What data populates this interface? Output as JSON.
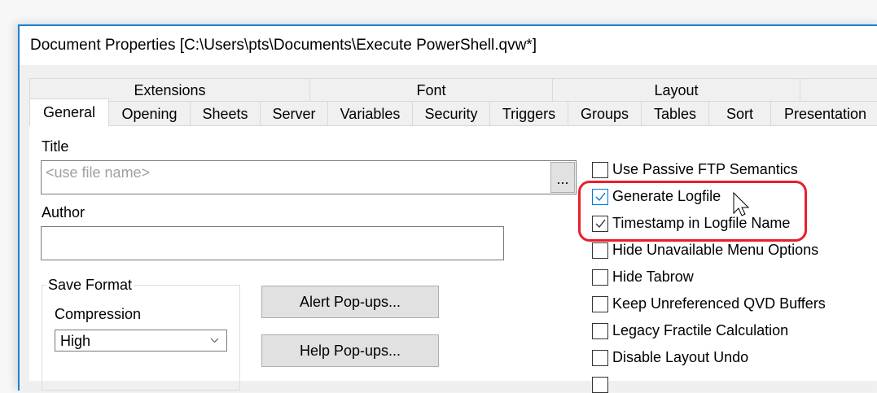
{
  "window": {
    "title": "Document Properties [C:\\Users\\pts\\Documents\\Execute PowerShell.qvw*]"
  },
  "tabs_row1": [
    "Extensions",
    "Font",
    "Layout",
    ""
  ],
  "tabs_row2": [
    "General",
    "Opening",
    "Sheets",
    "Server",
    "Variables",
    "Security",
    "Triggers",
    "Groups",
    "Tables",
    "Sort",
    "Presentation"
  ],
  "selected_tab": "General",
  "general": {
    "title_label": "Title",
    "title_value": "",
    "title_placeholder": "<use file name>",
    "browse_label": "...",
    "author_label": "Author",
    "author_value": "",
    "save_format_label": "Save Format",
    "compression_label": "Compression",
    "compression_value": "High",
    "alert_popups": "Alert Pop-ups...",
    "help_popups": "Help Pop-ups...",
    "checkboxes": [
      {
        "label": "Use Passive FTP Semantics",
        "checked": false
      },
      {
        "label": "Generate Logfile",
        "checked": true
      },
      {
        "label": "Timestamp in Logfile Name",
        "checked": true
      },
      {
        "label": "Hide Unavailable Menu Options",
        "checked": false
      },
      {
        "label": "Hide Tabrow",
        "checked": false
      },
      {
        "label": "Keep Unreferenced QVD Buffers",
        "checked": false
      },
      {
        "label": "Legacy Fractile Calculation",
        "checked": false
      },
      {
        "label": "Disable Layout Undo",
        "checked": false
      }
    ]
  },
  "colors": {
    "accent": "#1883d7",
    "highlight": "#e8202a",
    "check_focus": "#0078d7"
  }
}
